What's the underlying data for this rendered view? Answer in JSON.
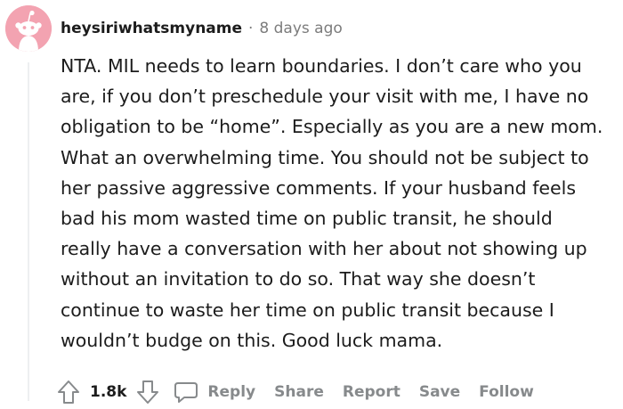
{
  "comment": {
    "username": "heysiriwhatsmyname",
    "separator": "·",
    "timestamp": "8 days ago",
    "avatar_color": "#f3a3b1",
    "body_lines": [
      "NTA. MIL needs to learn boundaries. I don’t care who you",
      "are, if you don’t preschedule your visit with me, I have no",
      "obligation to be “home”. Especially as you are a new mom.",
      "What an overwhelming time. You should not be subject to",
      "her passive aggressive comments. If your husband feels",
      "bad his mom wasted time on public transit, he should",
      "really have a conversation with her about not showing up",
      "without an invitation to do so. That way she doesn’t",
      "continue to waste her time on public transit because I",
      "wouldn’t budge on this. Good luck mama."
    ]
  },
  "actions": {
    "upvote_icon": "arrow-up-icon",
    "score": "1.8k",
    "downvote_icon": "arrow-down-icon",
    "reply_icon": "speech-bubble-icon",
    "reply": "Reply",
    "share": "Share",
    "report": "Report",
    "save": "Save",
    "follow": "Follow"
  },
  "colors": {
    "text": "#1c1c1c",
    "muted": "#7c7c7c",
    "action": "#878a8c",
    "thread_line": "#edeff1"
  }
}
